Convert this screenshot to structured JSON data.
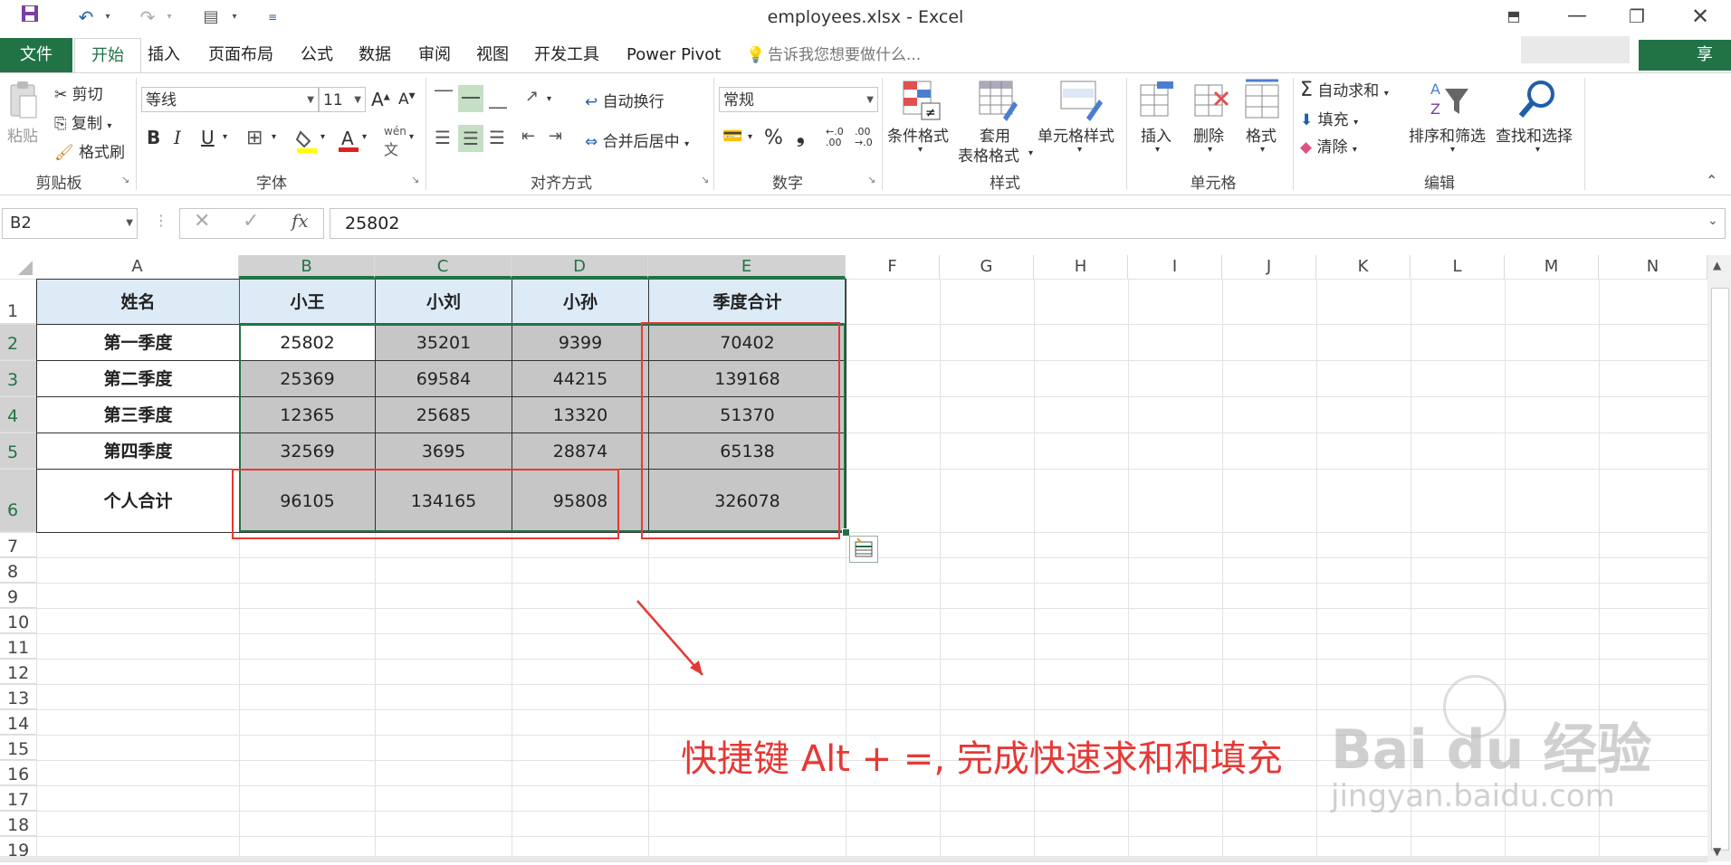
{
  "window": {
    "title": "employees.xlsx - Excel"
  },
  "ribbon_tabs": [
    "文件",
    "开始",
    "插入",
    "页面布局",
    "公式",
    "数据",
    "审阅",
    "视图",
    "开发工具",
    "Power Pivot"
  ],
  "tell_me": "告诉我您想要做什么...",
  "share_label": "享",
  "clipboard": {
    "paste": "粘贴",
    "cut": "剪切",
    "copy": "复制",
    "format_painter": "格式刷",
    "group": "剪贴板"
  },
  "font": {
    "name": "等线",
    "size": "11",
    "group": "字体",
    "bold": "B",
    "italic": "I",
    "underline": "U",
    "phonetic": "wén"
  },
  "alignment": {
    "wrap_text": "自动换行",
    "merge_center": "合并后居中",
    "group": "对齐方式"
  },
  "number": {
    "format": "常规",
    "percent": "%",
    "comma": "❟",
    "inc_decimal": "←.0 .00",
    "dec_decimal": ".00 →.0",
    "group": "数字"
  },
  "styles": {
    "conditional": "条件格式",
    "table_line1": "套用",
    "table_line2": "表格格式",
    "cell_styles": "单元格样式",
    "group": "样式"
  },
  "cells": {
    "insert": "插入",
    "delete": "删除",
    "format": "格式",
    "group": "单元格"
  },
  "editing": {
    "autosum": "自动求和",
    "fill": "填充",
    "clear": "清除",
    "sort_filter": "排序和筛选",
    "find_select": "查找和选择",
    "group": "编辑"
  },
  "formula_bar": {
    "name_box": "B2",
    "formula": "25802"
  },
  "columns": [
    "A",
    "B",
    "C",
    "D",
    "E",
    "F",
    "G",
    "H",
    "I",
    "J",
    "K",
    "L",
    "M",
    "N"
  ],
  "rows": [
    "1",
    "2",
    "3",
    "4",
    "5",
    "6",
    "7",
    "8",
    "9",
    "10",
    "11",
    "12",
    "13",
    "14",
    "15",
    "16",
    "17",
    "18",
    "19"
  ],
  "table": {
    "header": [
      "姓名",
      "小王",
      "小刘",
      "小孙",
      "季度合计"
    ],
    "body": [
      [
        "第一季度",
        "25802",
        "35201",
        "9399",
        "70402"
      ],
      [
        "第二季度",
        "25369",
        "69584",
        "44215",
        "139168"
      ],
      [
        "第三季度",
        "12365",
        "25685",
        "13320",
        "51370"
      ],
      [
        "第四季度",
        "32569",
        "3695",
        "28874",
        "65138"
      ],
      [
        "个人合计",
        "96105",
        "134165",
        "95808",
        "326078"
      ]
    ]
  },
  "annotation": "快捷键 Alt + =, 完成快速求和和填充",
  "watermark": {
    "brand": "Bai du 经验",
    "url": "jingyan.baidu.com"
  },
  "colors": {
    "excel_green": "#217346",
    "header_fill": "#ddebf7",
    "selection_fill": "#c6c6c6",
    "annotation_red": "#e53935"
  }
}
